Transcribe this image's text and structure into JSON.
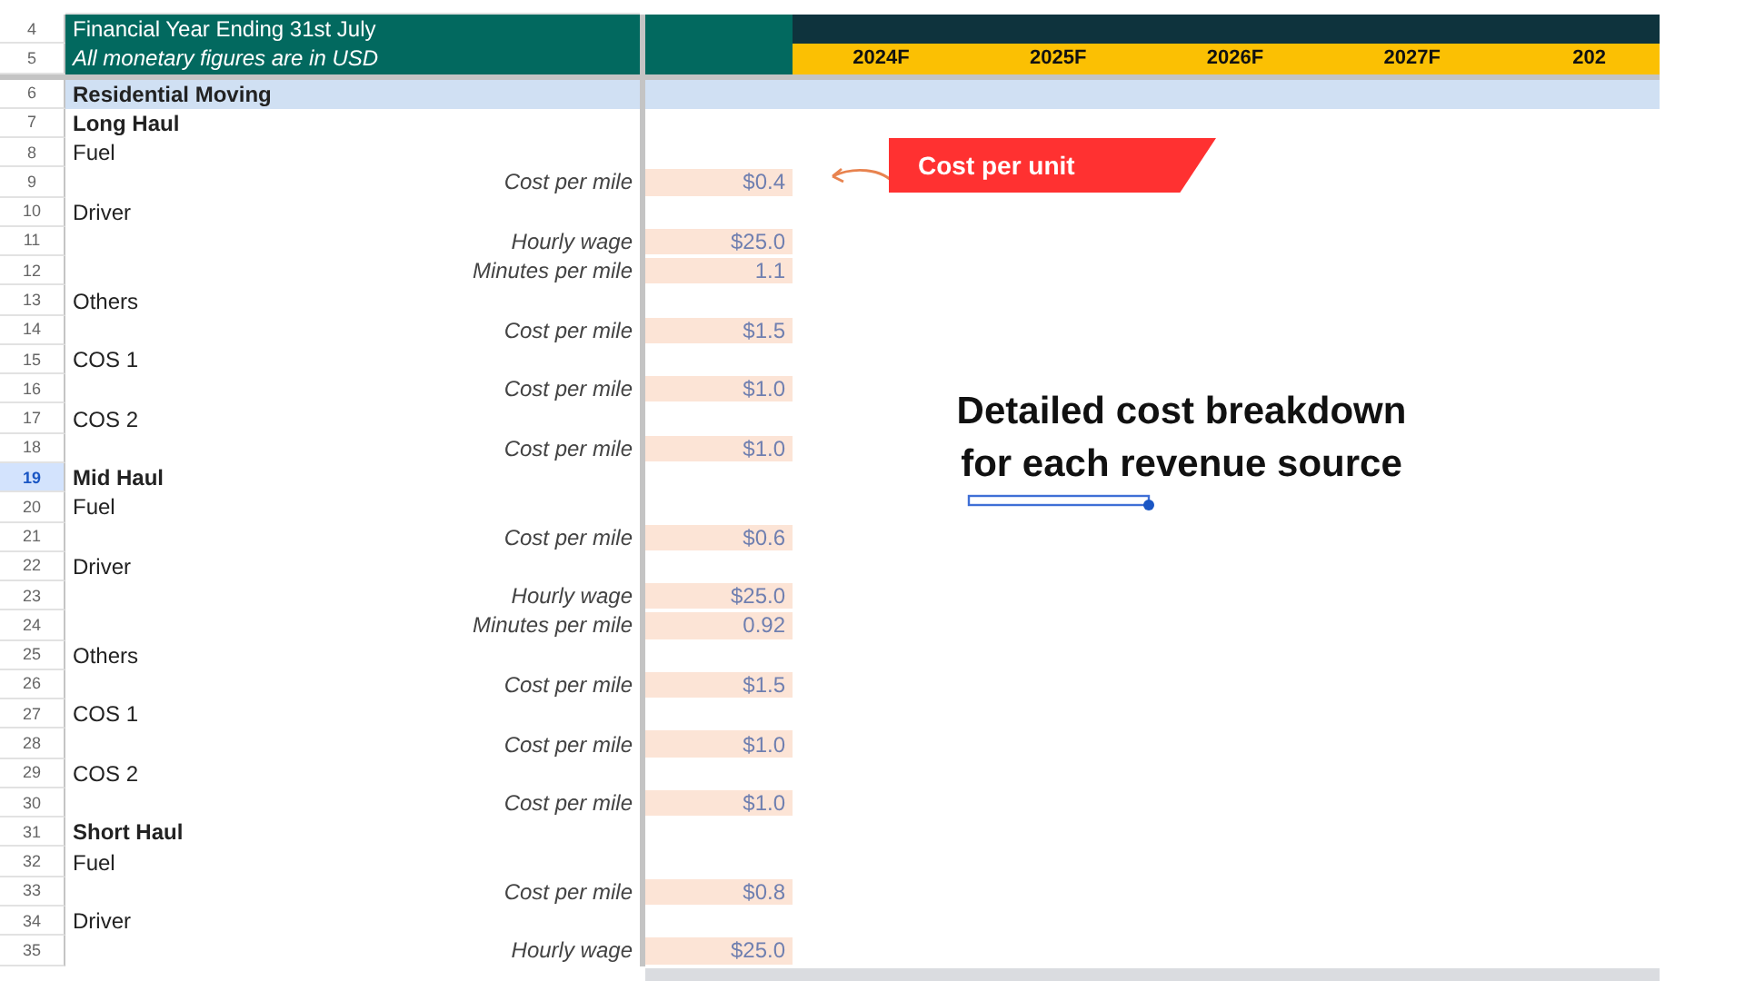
{
  "header": {
    "title": "Financial Year Ending 31st July",
    "subtitle": "All monetary figures are in USD",
    "row_numbers": [
      "4",
      "5"
    ]
  },
  "years": [
    "2024F",
    "2025F",
    "2026F",
    "2027F",
    "202"
  ],
  "section_row": {
    "number": "6",
    "label": "Residential Moving"
  },
  "rows": [
    {
      "number": "7",
      "kind": "group",
      "label": "Long Haul",
      "selected": false
    },
    {
      "number": "8",
      "kind": "item",
      "label": "Fuel",
      "selected": false
    },
    {
      "number": "9",
      "kind": "param",
      "label": "Cost per mile",
      "value": "$0.4",
      "selected": false
    },
    {
      "number": "10",
      "kind": "item",
      "label": "Driver",
      "selected": false
    },
    {
      "number": "11",
      "kind": "param",
      "label": "Hourly wage",
      "value": "$25.0",
      "selected": false
    },
    {
      "number": "12",
      "kind": "param",
      "label": "Minutes per mile",
      "value": "1.1",
      "selected": false
    },
    {
      "number": "13",
      "kind": "item",
      "label": "Others",
      "selected": false
    },
    {
      "number": "14",
      "kind": "param",
      "label": "Cost per mile",
      "value": "$1.5",
      "selected": false
    },
    {
      "number": "15",
      "kind": "item",
      "label": "COS 1",
      "selected": false
    },
    {
      "number": "16",
      "kind": "param",
      "label": "Cost per mile",
      "value": "$1.0",
      "selected": false
    },
    {
      "number": "17",
      "kind": "item",
      "label": "COS 2",
      "selected": false
    },
    {
      "number": "18",
      "kind": "param",
      "label": "Cost per mile",
      "value": "$1.0",
      "selected": false
    },
    {
      "number": "19",
      "kind": "group",
      "label": "Mid Haul",
      "selected": true
    },
    {
      "number": "20",
      "kind": "item",
      "label": "Fuel",
      "selected": false
    },
    {
      "number": "21",
      "kind": "param",
      "label": "Cost per mile",
      "value": "$0.6",
      "selected": false
    },
    {
      "number": "22",
      "kind": "item",
      "label": "Driver",
      "selected": false
    },
    {
      "number": "23",
      "kind": "param",
      "label": "Hourly wage",
      "value": "$25.0",
      "selected": false
    },
    {
      "number": "24",
      "kind": "param",
      "label": "Minutes per mile",
      "value": "0.92",
      "selected": false
    },
    {
      "number": "25",
      "kind": "item",
      "label": "Others",
      "selected": false
    },
    {
      "number": "26",
      "kind": "param",
      "label": "Cost per mile",
      "value": "$1.5",
      "selected": false
    },
    {
      "number": "27",
      "kind": "item",
      "label": "COS 1",
      "selected": false
    },
    {
      "number": "28",
      "kind": "param",
      "label": "Cost per mile",
      "value": "$1.0",
      "selected": false
    },
    {
      "number": "29",
      "kind": "item",
      "label": "COS 2",
      "selected": false
    },
    {
      "number": "30",
      "kind": "param",
      "label": "Cost per mile",
      "value": "$1.0",
      "selected": false
    },
    {
      "number": "31",
      "kind": "group",
      "label": "Short Haul",
      "selected": false
    },
    {
      "number": "32",
      "kind": "item",
      "label": "Fuel",
      "selected": false
    },
    {
      "number": "33",
      "kind": "param",
      "label": "Cost per mile",
      "value": "$0.8",
      "selected": false
    },
    {
      "number": "34",
      "kind": "item",
      "label": "Driver",
      "selected": false
    },
    {
      "number": "35",
      "kind": "param",
      "label": "Hourly wage",
      "value": "$25.0",
      "selected": false
    }
  ],
  "callout": {
    "label": "Cost per unit"
  },
  "note": {
    "text": "Detailed cost breakdown for each revenue source"
  }
}
